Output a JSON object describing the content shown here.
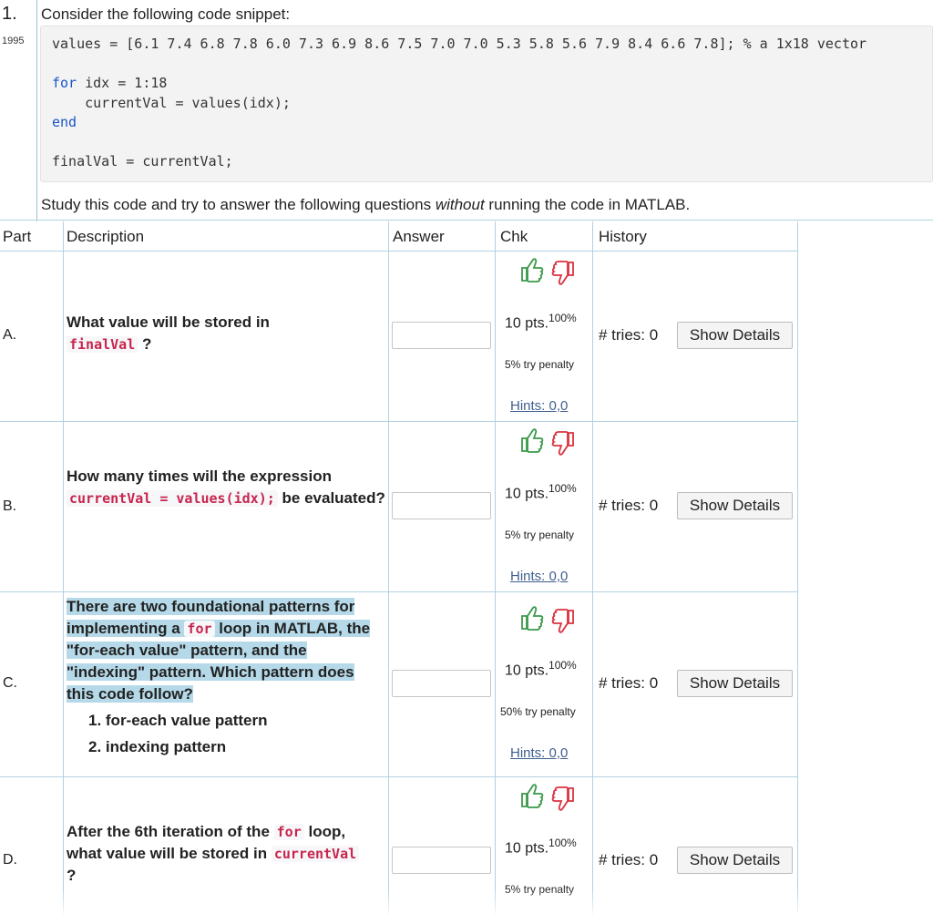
{
  "question": {
    "number": "1.",
    "id": "1995",
    "prompt": "Consider the following code snippet:",
    "code": {
      "line1_a": "values = [6.1 7.4 6.8 7.8 6.0 7.3 6.9 8.6 7.5 7.0 7.0 5.3 5.8 5.6 7.9 8.4 6.6 7.8]; % a 1x18 vector",
      "line2_kw": "for",
      "line2_rest": " idx = 1:18",
      "line3": "    currentVal = values(idx);",
      "line4_kw": "end",
      "line5": "finalVal = currentVal;"
    },
    "study_pre": "Study this code and try to answer the following questions ",
    "study_em": "without",
    "study_post": " running the code in MATLAB."
  },
  "table": {
    "headers": {
      "part": "Part",
      "description": "Description",
      "answer": "Answer",
      "chk": "Chk",
      "history": "History"
    }
  },
  "parts": [
    {
      "label": "A.",
      "q_text1": "What value will be stored in",
      "q_code1": "finalVal",
      "q_text2": "?",
      "answer": "",
      "points": "10 pts.",
      "percent": "100%",
      "penalty": "5% try penalty",
      "hints": "Hints: 0,0",
      "tries": "# tries: 0",
      "details": "Show Details"
    },
    {
      "label": "B.",
      "q_text1": "How many times will the expression",
      "q_code1": "currentVal = values(idx);",
      "q_text2": "be evaluated?",
      "answer": "",
      "points": "10 pts.",
      "percent": "100%",
      "penalty": "5% try penalty",
      "hints": "Hints: 0,0",
      "tries": "# tries: 0",
      "details": "Show Details"
    },
    {
      "label": "C.",
      "q_text1": "There are two foundational patterns for implementing a",
      "q_code1": "for",
      "q_text2": "loop in MATLAB, the \"for-each value\" pattern, and the \"indexing\" pattern. Which pattern does this code follow?",
      "options": [
        "1. for-each value pattern",
        "2. indexing pattern"
      ],
      "answer": "",
      "points": "10 pts.",
      "percent": "100%",
      "penalty": "50% try penalty",
      "hints": "Hints: 0,0",
      "tries": "# tries: 0",
      "details": "Show Details"
    },
    {
      "label": "D.",
      "q_text1": "After the 6th iteration of the",
      "q_code1": "for",
      "q_text2": "loop, what value will be stored in",
      "q_code2": "currentVal",
      "q_text3": "?",
      "answer": "",
      "points": "10 pts.",
      "percent": "100%",
      "penalty": "5% try penalty",
      "tries": "# tries: 0",
      "details": "Show Details"
    }
  ],
  "icons": {
    "thumbs_up": "thumbs-up-icon",
    "thumbs_down": "thumbs-down-icon"
  },
  "colors": {
    "thumbs_up": "#3a9a4a",
    "thumbs_down": "#d9333f",
    "link": "#3f5f8f",
    "code_keyword": "#1b54c9",
    "code_inline": "#c7254e",
    "highlight": "#b5d9e8"
  }
}
